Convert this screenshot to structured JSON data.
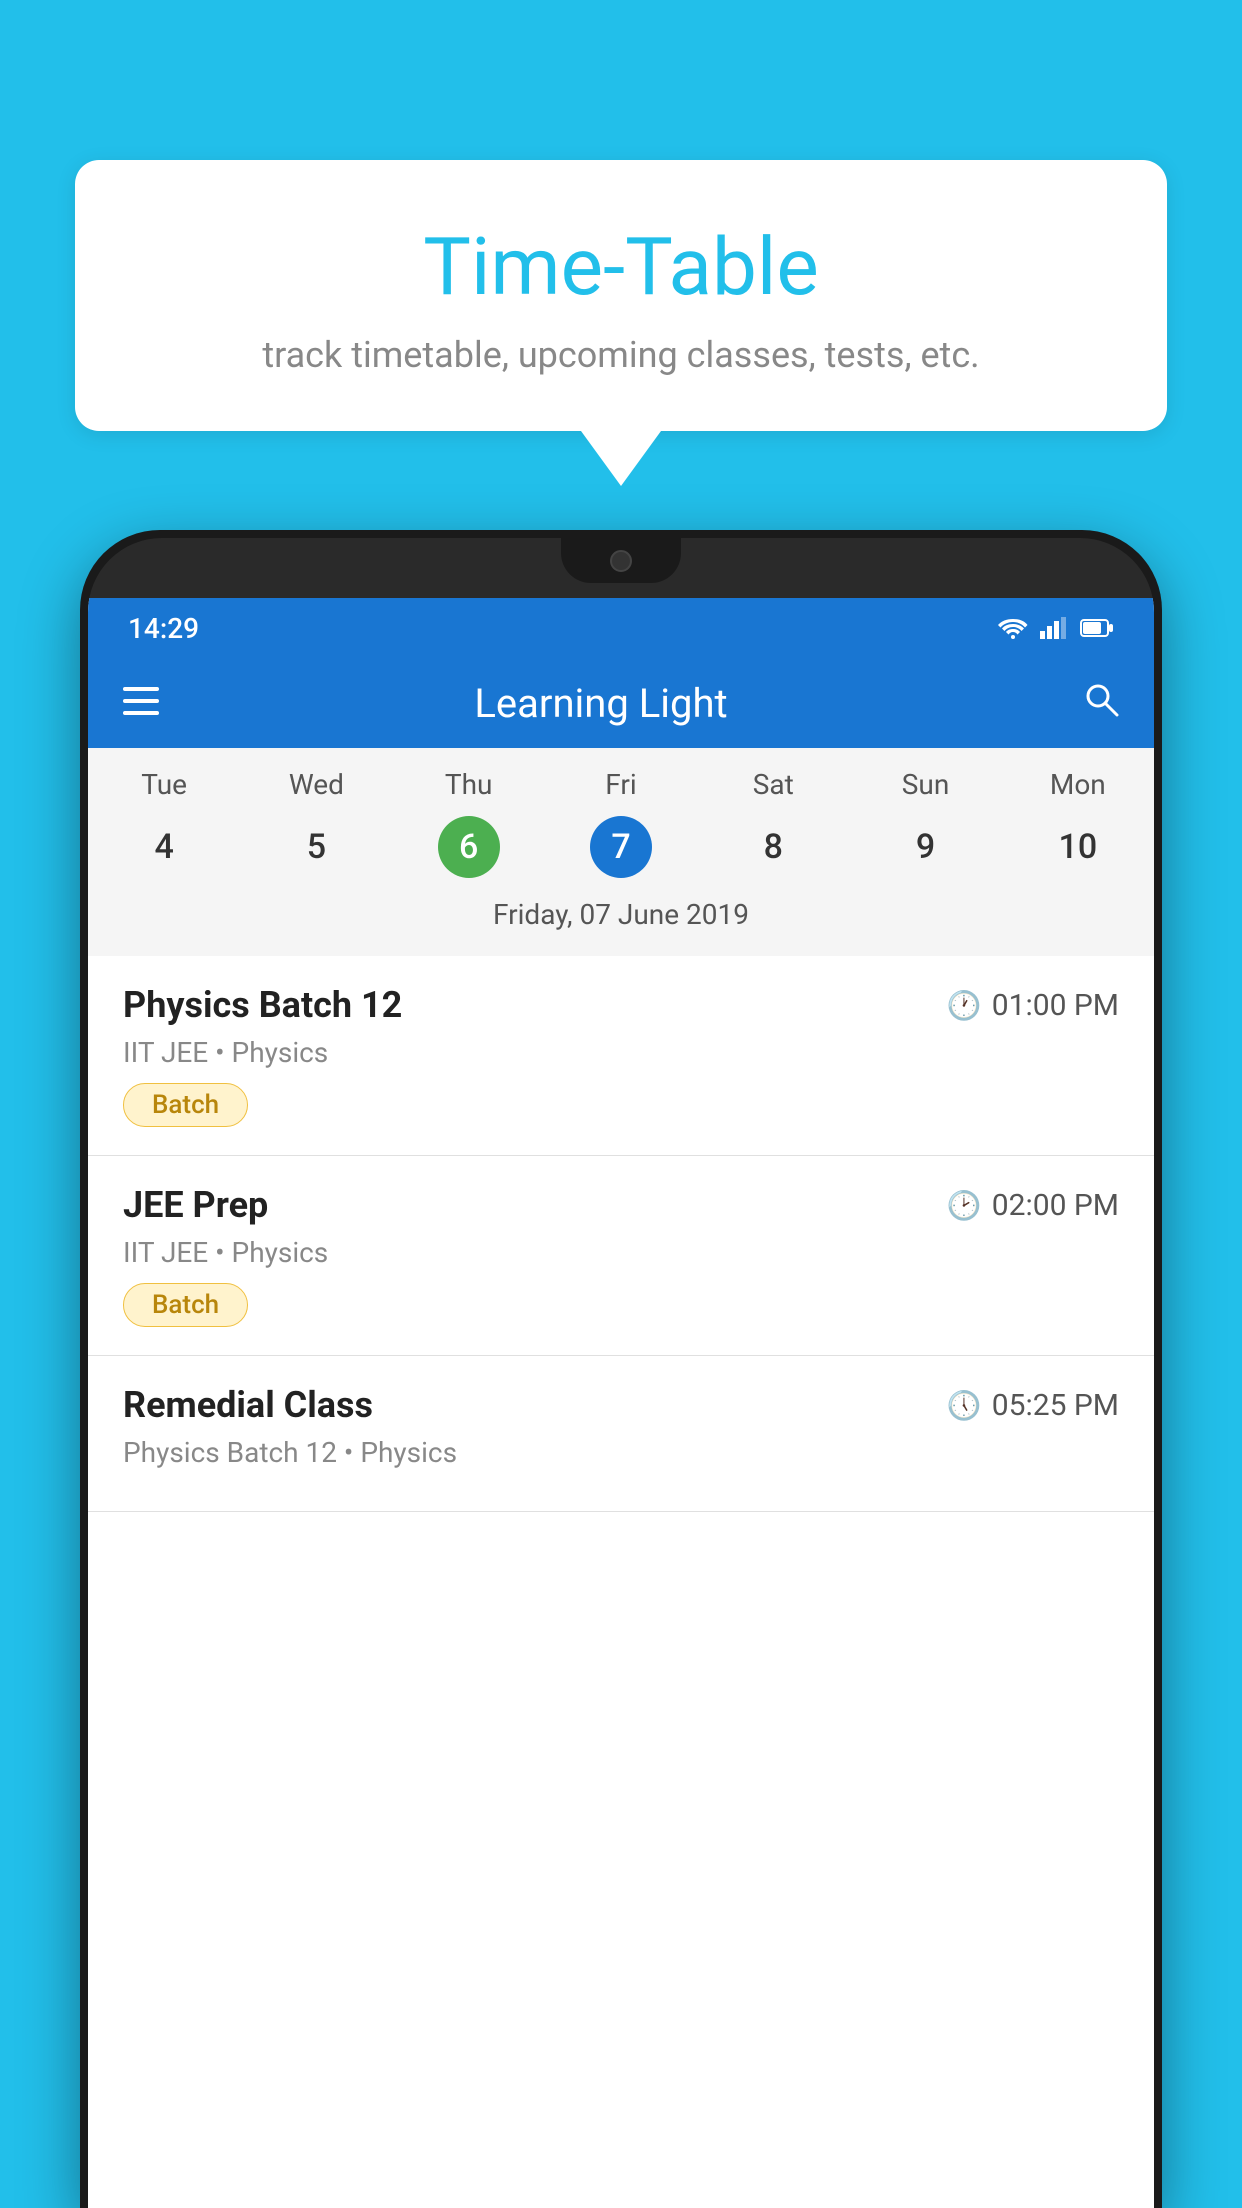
{
  "background_color": "#22BFEA",
  "speech_bubble": {
    "title": "Time-Table",
    "subtitle": "track timetable, upcoming classes, tests, etc."
  },
  "phone": {
    "status_bar": {
      "time": "14:29"
    },
    "app_bar": {
      "title": "Learning Light"
    },
    "calendar": {
      "days": [
        {
          "label": "Tue",
          "number": "4"
        },
        {
          "label": "Wed",
          "number": "5"
        },
        {
          "label": "Thu",
          "number": "6",
          "state": "today"
        },
        {
          "label": "Fri",
          "number": "7",
          "state": "selected"
        },
        {
          "label": "Sat",
          "number": "8"
        },
        {
          "label": "Sun",
          "number": "9"
        },
        {
          "label": "Mon",
          "number": "10"
        }
      ],
      "selected_date": "Friday, 07 June 2019"
    },
    "schedule": [
      {
        "title": "Physics Batch 12",
        "time": "01:00 PM",
        "subtitle": "IIT JEE • Physics",
        "tag": "Batch"
      },
      {
        "title": "JEE Prep",
        "time": "02:00 PM",
        "subtitle": "IIT JEE • Physics",
        "tag": "Batch"
      },
      {
        "title": "Remedial Class",
        "time": "05:25 PM",
        "subtitle": "Physics Batch 12 • Physics",
        "tag": null
      }
    ]
  }
}
